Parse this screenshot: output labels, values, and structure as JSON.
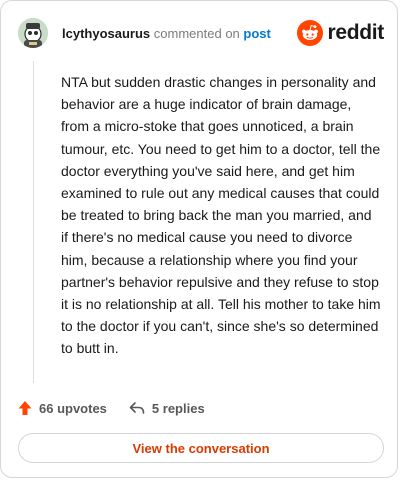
{
  "header": {
    "username": "lcythyosaurus",
    "action_text": "commented on",
    "post_link": "post",
    "brand": "reddit"
  },
  "comment": {
    "body": "NTA but sudden drastic changes in personality and behavior are a huge indicator of brain damage, from a micro-stoke that goes unnoticed, a brain tumour, etc. You need to get him to a doctor, tell the doctor everything you've said here, and get him examined to rule out any medical causes that could be treated to bring back the man you married, and if there's no medical cause you need to divorce him, because a relationship where you find your partner's behavior repulsive and they refuse to stop it is no relationship at all. Tell his mother to take him to the doctor if you can't, since she's so determined to butt in."
  },
  "actions": {
    "upvotes": "66 upvotes",
    "replies": "5 replies"
  },
  "cta": {
    "label": "View the conversation"
  },
  "icons": {
    "upvote": "upvote-arrow-icon",
    "reply": "reply-arrow-icon",
    "brand": "reddit-snoo-icon",
    "avatar": "user-avatar"
  },
  "colors": {
    "brand_orange": "#ff4500",
    "link_blue": "#0079d3",
    "cta_text": "#d93a00",
    "muted": "#7c7c7c"
  }
}
